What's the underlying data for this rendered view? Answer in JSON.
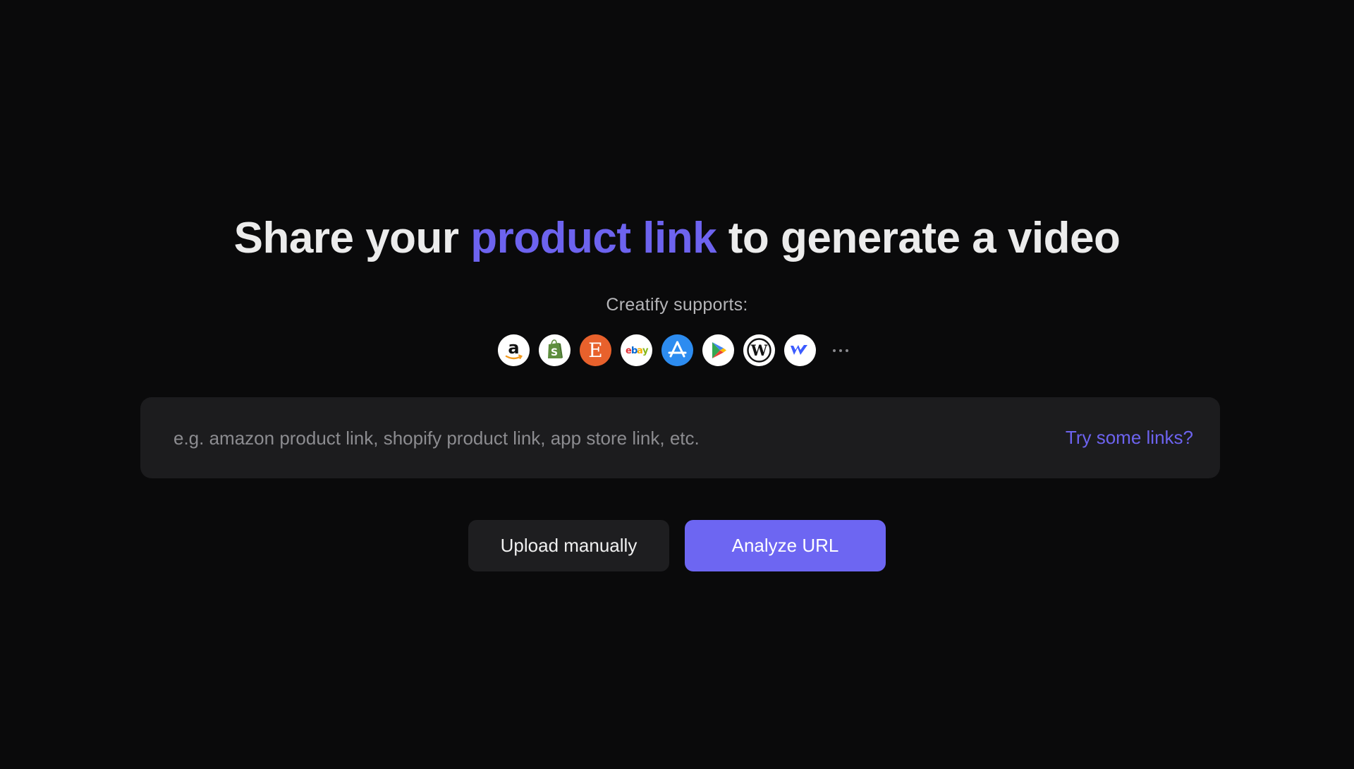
{
  "headline": {
    "part1": "Share your ",
    "accent": "product link",
    "part2": " to generate a video"
  },
  "supports": {
    "label": "Creatify supports:",
    "platforms": [
      {
        "name": "amazon",
        "icon": "amazon-icon"
      },
      {
        "name": "shopify",
        "icon": "shopify-icon"
      },
      {
        "name": "etsy",
        "icon": "etsy-icon"
      },
      {
        "name": "ebay",
        "icon": "ebay-icon"
      },
      {
        "name": "app store",
        "icon": "app-store-icon"
      },
      {
        "name": "google play",
        "icon": "google-play-icon"
      },
      {
        "name": "wordpress",
        "icon": "wordpress-icon"
      },
      {
        "name": "webflow",
        "icon": "webflow-icon"
      }
    ],
    "more_icon": "more-dots-icon"
  },
  "url_input": {
    "value": "",
    "placeholder": "e.g. amazon product link, shopify product link, app store link, etc.",
    "try_links_label": "Try some links?"
  },
  "actions": {
    "upload_label": "Upload manually",
    "analyze_label": "Analyze URL"
  },
  "colors": {
    "background": "#0a0a0b",
    "accent": "#6d63ef",
    "primary_button": "#6d66f2",
    "surface": "#1c1c1e"
  }
}
